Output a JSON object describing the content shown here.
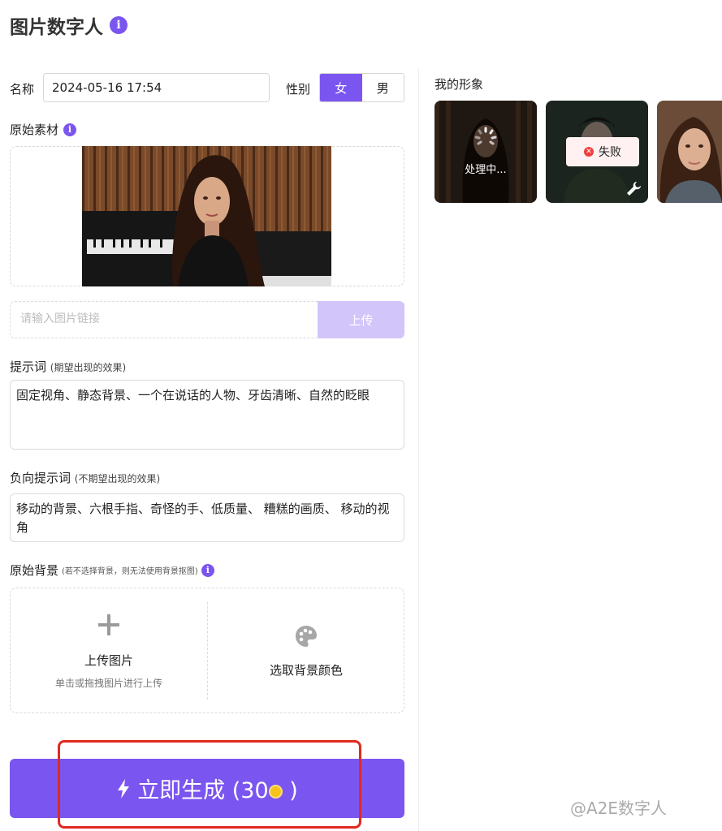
{
  "header": {
    "title": "图片数字人"
  },
  "form": {
    "name_label": "名称",
    "name_value": "2024-05-16 17:54",
    "gender_label": "性别",
    "gender_options": [
      "女",
      "男"
    ],
    "gender_selected": "女",
    "source_label": "原始素材",
    "url_placeholder": "请输入图片链接",
    "upload_button": "上传",
    "prompt_label": "提示词",
    "prompt_hint": "(期望出现的效果)",
    "prompt_value": "固定视角、静态背景、一个在说话的人物、牙齿清晰、自然的眨眼",
    "negative_label": "负向提示词",
    "negative_hint": "(不期望出现的效果)",
    "negative_value": "移动的背景、六根手指、奇怪的手、低质量、 糟糕的画质、 移动的视角",
    "bg_label": "原始背景",
    "bg_hint": "(若不选择背景，则无法使用背景抠图)",
    "bg_upload_title": "上传图片",
    "bg_upload_sub": "单击或拖拽图片进行上传",
    "bg_color_title": "选取背景颜色"
  },
  "generate": {
    "label": "立即生成 (30",
    "close": ")"
  },
  "right": {
    "title": "我的形象",
    "avatars": [
      {
        "status": "处理中..."
      },
      {
        "status": "失败"
      },
      {
        "status": ""
      }
    ]
  },
  "watermark": "@A2E数字人",
  "colors": {
    "accent": "#7b55f0",
    "accent_light": "#d2c5fa",
    "error": "#ee4040",
    "highlight": "#e02a1f"
  }
}
